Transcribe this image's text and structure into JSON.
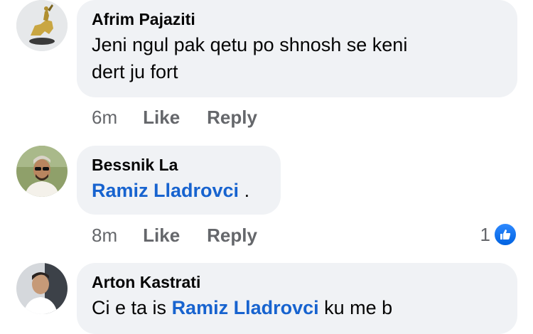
{
  "comments": [
    {
      "author": "Afrim Pajaziti",
      "text_line1": "Jeni ngul pak qetu po shnosh se keni",
      "text_line2": "dert ju fort",
      "time": "6m",
      "like_label": "Like",
      "reply_label": "Reply"
    },
    {
      "author": "Bessnik La",
      "mention": "Ramiz Lladrovci",
      "text_after_mention": " .",
      "time": "8m",
      "like_label": "Like",
      "reply_label": "Reply",
      "reaction_count": "1",
      "reaction_icon": "like-thumb-icon"
    },
    {
      "author": "Arton Kastrati",
      "partial_text": "Ci e ta is",
      "mention_partial": "Ramiz Lladrovci",
      "partial_after": " ku me b"
    }
  ],
  "colors": {
    "bubble": "#f0f2f5",
    "mention": "#1763cf",
    "meta": "#65676b",
    "like_badge": "#1877f2"
  }
}
